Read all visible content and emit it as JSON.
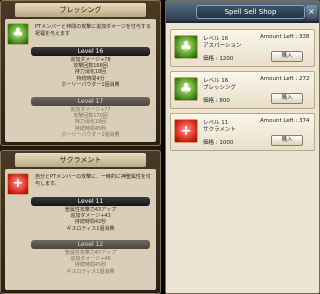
{
  "skill_cards": [
    {
      "title": "ブレッシング",
      "icon": "blessing-icon",
      "icon_color": "#3f8a1f",
      "glyph": "♣",
      "description": "PTメンバーと仲間の攻撃に追加ダメージを付与する祝福を与えます",
      "levels": [
        {
          "label": "Level 16",
          "stats": [
            "追加ダメージ+78",
            "攻撃回数168回",
            "持力消化18回",
            "持続時間4分",
            "ホーリーパウダー1個消費"
          ]
        },
        {
          "label": "Level 17",
          "stats": [
            "追加ダメージ+77",
            "攻撃回数170回",
            "持力消化18回",
            "持続時間45秒",
            "ホーリーパウダー1個消費"
          ]
        }
      ]
    },
    {
      "title": "サクラメント",
      "icon": "sacrament-icon",
      "icon_color": "#d8261c",
      "glyph": "+",
      "description": "自分とPTメンバーの攻撃に、一時的に神聖属性を付与します。",
      "levels": [
        {
          "label": "Level 11",
          "stats": [
            "聖属性攻撃力43アップ",
            "追加ダメージ+43",
            "持続時間42秒",
            "ギスロティス1個消費"
          ]
        },
        {
          "label": "Level 12",
          "stats": [
            "聖属性攻撃力47アップ",
            "追加ダメージ+46",
            "持続時間45秒",
            "ギスロティス1個消費"
          ]
        }
      ]
    }
  ],
  "shop": {
    "title": "Spell Sell Shop",
    "close_icon": "close-icon",
    "items": [
      {
        "level": "レベル 16",
        "name": "アスパーション",
        "amount": "Amount Left : 338",
        "price": "価格 : 1200",
        "buy": "購入",
        "icon": "aspersion-icon",
        "glyph": "♣"
      },
      {
        "level": "レベル 16",
        "name": "ブレッシング",
        "amount": "Amount Left : 272",
        "price": "価格 : 800",
        "buy": "購入",
        "icon": "blessing-icon",
        "glyph": "♣"
      },
      {
        "level": "レベル 11",
        "name": "サクラメント",
        "amount": "Amount Left : 374",
        "price": "価格 : 1000",
        "buy": "購入",
        "icon": "sacrament-icon",
        "glyph": "+"
      }
    ]
  }
}
